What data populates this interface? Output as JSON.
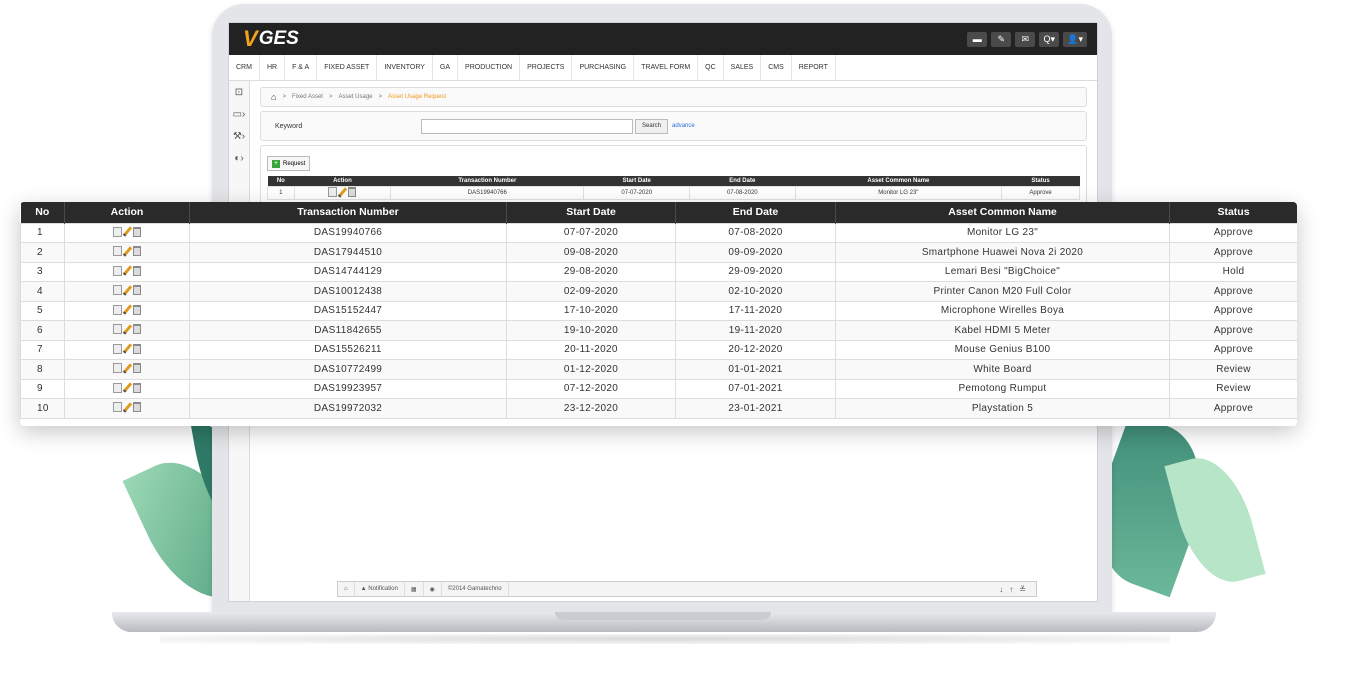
{
  "app": {
    "logo_v": "V",
    "logo_text": "GES"
  },
  "header_tools": [
    "▬",
    "✎",
    "✉",
    "Q▾",
    "👤▾"
  ],
  "menu": [
    "CRM",
    "HR",
    "F & A",
    "FIXED ASSET",
    "INVENTORY",
    "GA",
    "PRODUCTION",
    "PROJECTS",
    "PURCHASING",
    "TRAVEL FORM",
    "QC",
    "SALES",
    "CMS",
    "REPORT"
  ],
  "breadcrumb": {
    "items": [
      "Fixed Asset",
      "Asset Usage"
    ],
    "active": "Asset Usage Request",
    "sep": ">"
  },
  "search": {
    "label": "Keyword",
    "value": "",
    "button": "Search",
    "advance": "advance"
  },
  "request_button": "Request",
  "table": {
    "headers": [
      "No",
      "Action",
      "Transaction Number",
      "Start Date",
      "End Date",
      "Asset Common Name",
      "Status"
    ],
    "rows": [
      {
        "no": "1",
        "trx": "DAS19940766",
        "start": "07-07-2020",
        "end": "07-08-2020",
        "asset": "Monitor LG 23\"",
        "status": "Approve"
      },
      {
        "no": "2",
        "trx": "DAS17944510",
        "start": "09-08-2020",
        "end": "09-09-2020",
        "asset": "Smartphone Huawei Nova 2i 2020",
        "status": "Approve"
      },
      {
        "no": "3",
        "trx": "DAS14744129",
        "start": "29-08-2020",
        "end": "29-09-2020",
        "asset": "Lemari Besi \"BigChoice\"",
        "status": "Hold"
      },
      {
        "no": "4",
        "trx": "DAS10012438",
        "start": "02-09-2020",
        "end": "02-10-2020",
        "asset": "Printer Canon M20 Full Color",
        "status": "Approve"
      },
      {
        "no": "5",
        "trx": "DAS15152447",
        "start": "17-10-2020",
        "end": "17-11-2020",
        "asset": "Microphone Wirelles Boya",
        "status": "Approve"
      },
      {
        "no": "6",
        "trx": "DAS11842655",
        "start": "19-10-2020",
        "end": "19-11-2020",
        "asset": "Kabel HDMI 5 Meter",
        "status": "Approve"
      },
      {
        "no": "7",
        "trx": "DAS15526211",
        "start": "20-11-2020",
        "end": "20-12-2020",
        "asset": "Mouse Genius B100",
        "status": "Approve"
      },
      {
        "no": "8",
        "trx": "DAS10772499",
        "start": "01-12-2020",
        "end": "01-01-2021",
        "asset": "White Board",
        "status": "Review"
      },
      {
        "no": "9",
        "trx": "DAS19923957",
        "start": "07-12-2020",
        "end": "07-01-2021",
        "asset": "Pemotong Rumput",
        "status": "Review"
      },
      {
        "no": "10",
        "trx": "DAS19972032",
        "start": "23-12-2020",
        "end": "23-01-2021",
        "asset": "Playstation 5",
        "status": "Approve"
      }
    ]
  },
  "footer": {
    "notification": "▲ Notification",
    "copyright": "©2014 Gamatechno",
    "home": "⌂",
    "doc": "▦",
    "globe": "◉",
    "down": "↓",
    "up": "↑",
    "collapse": "≚"
  },
  "colors": {
    "approve": "#2fb52f",
    "hold": "#d93030",
    "review": "#444444",
    "accent": "#f3a21d"
  }
}
